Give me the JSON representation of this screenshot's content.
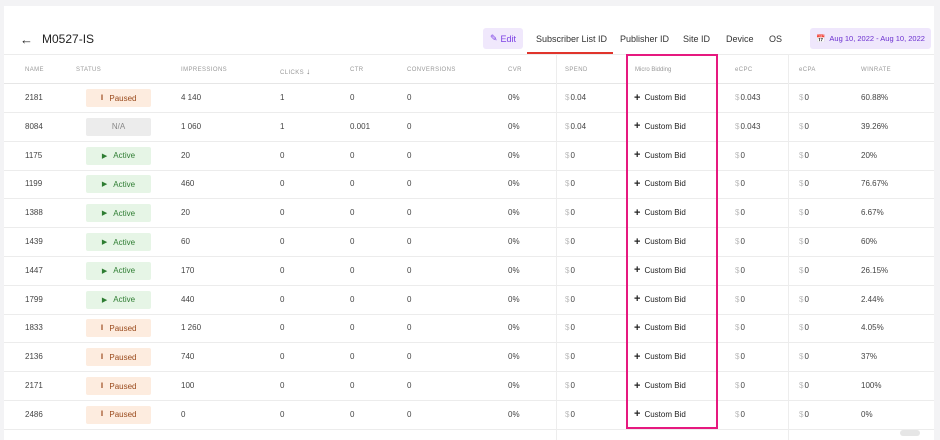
{
  "header": {
    "back_icon": "arrow-left-icon",
    "title": "M0527-IS",
    "edit_label": "Edit",
    "tabs": [
      "Subscriber List ID",
      "Publisher ID",
      "Site ID",
      "Device",
      "OS"
    ],
    "active_tab": "Subscriber List ID",
    "date_range": "Aug 10, 2022 - Aug 10, 2022",
    "accent_color": "#7b3fe4",
    "active_tab_color": "#e0342c"
  },
  "table": {
    "columns": [
      "NAME",
      "STATUS",
      "IMPRESSIONS",
      "CLICKS",
      "CTR",
      "CONVERSIONS",
      "CVR",
      "SPEND",
      "Micro Bidding",
      "eCPC",
      "eCPA",
      "WINRATE"
    ],
    "sort_column": "CLICKS",
    "sort_direction": "desc",
    "custom_bid_label": "Custom Bid",
    "rows": [
      {
        "name": "2181",
        "status": "Paused",
        "impressions": "4 140",
        "clicks": "1",
        "ctr": "0",
        "conversions": "0",
        "cvr": "0%",
        "spend": "0.04",
        "ecpc": "0.043",
        "ecpa": "0",
        "winrate": "60.88%"
      },
      {
        "name": "8084",
        "status": "N/A",
        "impressions": "1 060",
        "clicks": "1",
        "ctr": "0.001",
        "conversions": "0",
        "cvr": "0%",
        "spend": "0.04",
        "ecpc": "0.043",
        "ecpa": "0",
        "winrate": "39.26%"
      },
      {
        "name": "1175",
        "status": "Active",
        "impressions": "20",
        "clicks": "0",
        "ctr": "0",
        "conversions": "0",
        "cvr": "0%",
        "spend": "0",
        "ecpc": "0",
        "ecpa": "0",
        "winrate": "20%"
      },
      {
        "name": "1199",
        "status": "Active",
        "impressions": "460",
        "clicks": "0",
        "ctr": "0",
        "conversions": "0",
        "cvr": "0%",
        "spend": "0",
        "ecpc": "0",
        "ecpa": "0",
        "winrate": "76.67%"
      },
      {
        "name": "1388",
        "status": "Active",
        "impressions": "20",
        "clicks": "0",
        "ctr": "0",
        "conversions": "0",
        "cvr": "0%",
        "spend": "0",
        "ecpc": "0",
        "ecpa": "0",
        "winrate": "6.67%"
      },
      {
        "name": "1439",
        "status": "Active",
        "impressions": "60",
        "clicks": "0",
        "ctr": "0",
        "conversions": "0",
        "cvr": "0%",
        "spend": "0",
        "ecpc": "0",
        "ecpa": "0",
        "winrate": "60%"
      },
      {
        "name": "1447",
        "status": "Active",
        "impressions": "170",
        "clicks": "0",
        "ctr": "0",
        "conversions": "0",
        "cvr": "0%",
        "spend": "0",
        "ecpc": "0",
        "ecpa": "0",
        "winrate": "26.15%"
      },
      {
        "name": "1799",
        "status": "Active",
        "impressions": "440",
        "clicks": "0",
        "ctr": "0",
        "conversions": "0",
        "cvr": "0%",
        "spend": "0",
        "ecpc": "0",
        "ecpa": "0",
        "winrate": "2.44%"
      },
      {
        "name": "1833",
        "status": "Paused",
        "impressions": "1 260",
        "clicks": "0",
        "ctr": "0",
        "conversions": "0",
        "cvr": "0%",
        "spend": "0",
        "ecpc": "0",
        "ecpa": "0",
        "winrate": "4.05%"
      },
      {
        "name": "2136",
        "status": "Paused",
        "impressions": "740",
        "clicks": "0",
        "ctr": "0",
        "conversions": "0",
        "cvr": "0%",
        "spend": "0",
        "ecpc": "0",
        "ecpa": "0",
        "winrate": "37%"
      },
      {
        "name": "2171",
        "status": "Paused",
        "impressions": "100",
        "clicks": "0",
        "ctr": "0",
        "conversions": "0",
        "cvr": "0%",
        "spend": "0",
        "ecpc": "0",
        "ecpa": "0",
        "winrate": "100%"
      },
      {
        "name": "2486",
        "status": "Paused",
        "impressions": "0",
        "clicks": "0",
        "ctr": "0",
        "conversions": "0",
        "cvr": "0%",
        "spend": "0",
        "ecpc": "0",
        "ecpa": "0",
        "winrate": "0%"
      }
    ]
  },
  "highlight": {
    "target": "Micro Bidding",
    "color": "#e6197f"
  }
}
